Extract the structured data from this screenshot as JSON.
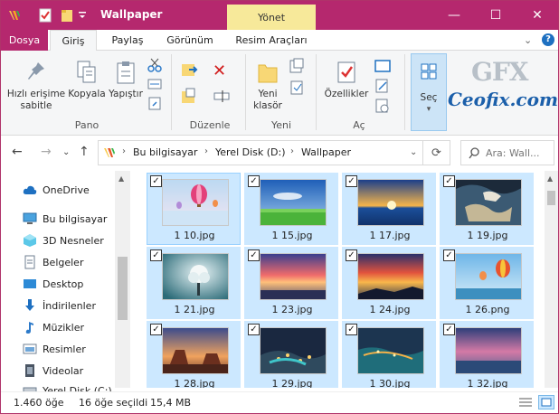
{
  "window": {
    "title": "Wallpaper",
    "context_tab": "Yönet",
    "min": "—",
    "max": "☐",
    "close": "✕",
    "accent": "#b5286e"
  },
  "tabs": [
    "Dosya",
    "Giriş",
    "Paylaş",
    "Görünüm",
    "Resim Araçları"
  ],
  "ribbon": {
    "pano": {
      "pin_label": "Hızlı erişime sabitle",
      "copy_label": "Kopyala",
      "paste_label": "Yapıştır",
      "group": "Pano"
    },
    "duzenle": {
      "group": "Düzenle"
    },
    "yeni": {
      "new_folder_label": "Yeni klasör",
      "group": "Yeni"
    },
    "ac": {
      "properties_label": "Özellikler",
      "group": "Aç"
    },
    "sec": {
      "label": "Seç"
    }
  },
  "watermark": {
    "top": "GFX",
    "bottom": "Ceofix.com"
  },
  "address": {
    "crumbs": [
      "Bu bilgisayar",
      "Yerel Disk (D:)",
      "Wallpaper"
    ],
    "search_placeholder": "Ara: Wall..."
  },
  "nav_pane": [
    {
      "label": "OneDrive",
      "icon": "cloud-icon"
    },
    {
      "label": "Bu bilgisayar",
      "icon": "computer-icon"
    },
    {
      "label": "3D Nesneler",
      "icon": "cube-icon"
    },
    {
      "label": "Belgeler",
      "icon": "document-icon"
    },
    {
      "label": "Desktop",
      "icon": "desktop-icon"
    },
    {
      "label": "İndirilenler",
      "icon": "download-icon"
    },
    {
      "label": "Müzikler",
      "icon": "music-icon"
    },
    {
      "label": "Resimler",
      "icon": "pictures-icon"
    },
    {
      "label": "Videolar",
      "icon": "video-icon"
    },
    {
      "label": "Yerel Disk (C:)",
      "icon": "drive-icon"
    }
  ],
  "files": [
    {
      "name": "1 10.jpg",
      "theme": "balloon-sky"
    },
    {
      "name": "1 15.jpg",
      "theme": "green-field"
    },
    {
      "name": "1 17.jpg",
      "theme": "sunset-sea"
    },
    {
      "name": "1 19.jpg",
      "theme": "earth-space"
    },
    {
      "name": "1 21.jpg",
      "theme": "misty-tree"
    },
    {
      "name": "1 23.jpg",
      "theme": "pink-sunset"
    },
    {
      "name": "1 24.jpg",
      "theme": "fiery-sky"
    },
    {
      "name": "1 26.png",
      "theme": "balloons-sea"
    },
    {
      "name": "1 28.jpg",
      "theme": "canyon-dusk"
    },
    {
      "name": "1 29.jpg",
      "theme": "city-night"
    },
    {
      "name": "1 30.jpg",
      "theme": "coast-night"
    },
    {
      "name": "1 32.jpg",
      "theme": "purple-sea"
    }
  ],
  "status": {
    "count": "1.460 öğe",
    "selected": "16 öğe seçildi",
    "size": "15,4 MB"
  }
}
